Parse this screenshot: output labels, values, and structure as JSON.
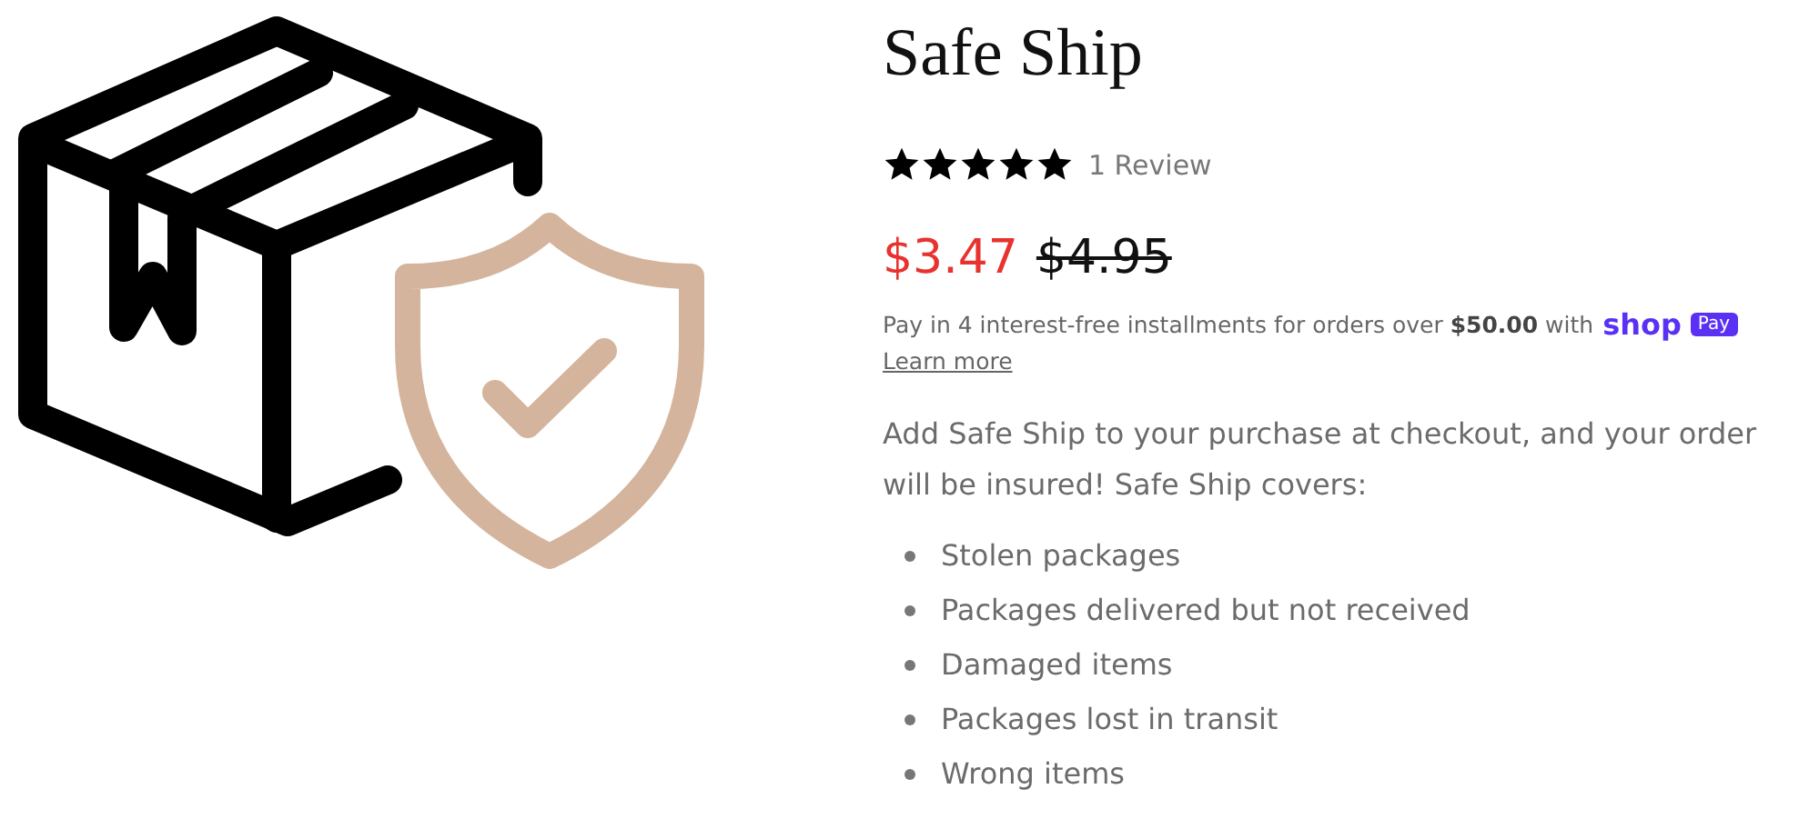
{
  "product": {
    "title": "Safe Ship",
    "stars": 5,
    "review_count": "1 Review",
    "sale_price": "$3.47",
    "original_price": "$4.95",
    "installments": "Pay in 4 interest-free installments for orders over **$50.00** with",
    "shop_logo": "shop",
    "pay_badge": "Pay",
    "learn_more": "Learn more",
    "description": "Add Safe Ship to your purchase at checkout, and your order will be insured! Safe Ship covers:",
    "covers": [
      "Stolen packages",
      "Packages delivered but not received",
      "Damaged items",
      "Packages lost in transit",
      "Wrong items"
    ]
  }
}
